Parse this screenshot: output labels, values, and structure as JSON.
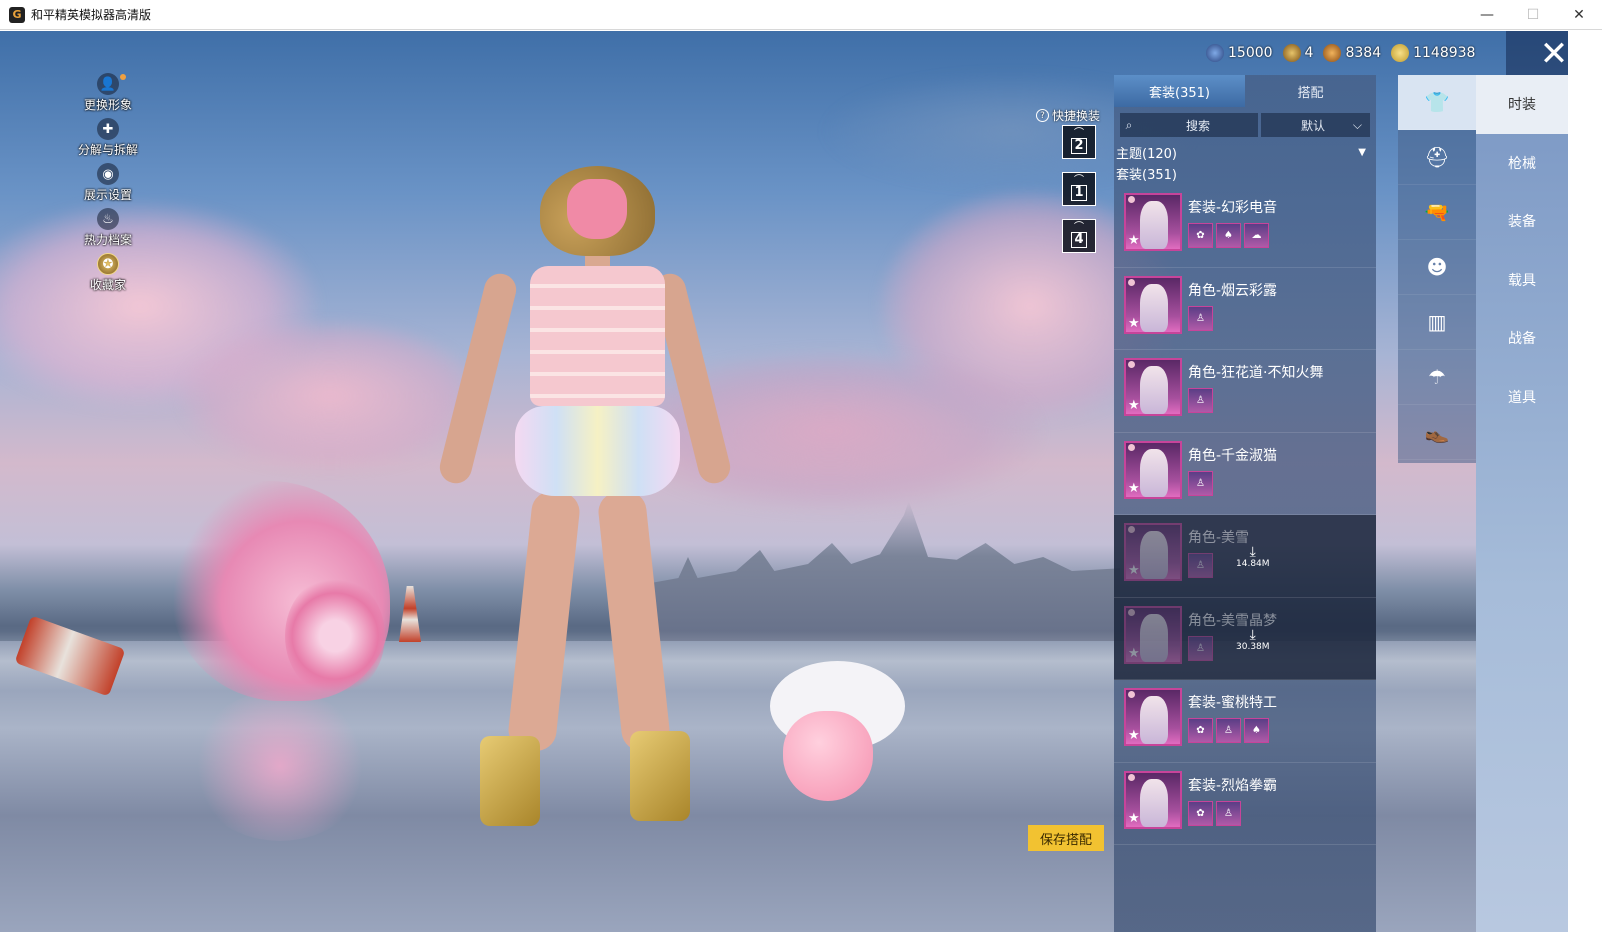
{
  "window": {
    "app_icon": "G",
    "title": "和平精英模拟器高清版",
    "controls": {
      "minimize": "—",
      "maximize": "☐",
      "close": "✕"
    }
  },
  "left_menu": [
    {
      "label": "更换形象",
      "icon": "person-icon",
      "glyph": "👤"
    },
    {
      "label": "分解与拆解",
      "icon": "puzzle-icon",
      "glyph": "✚"
    },
    {
      "label": "展示设置",
      "icon": "eye-icon",
      "glyph": "◉"
    },
    {
      "label": "热力档案",
      "icon": "flame-icon",
      "glyph": "♨"
    },
    {
      "label": "收藏家",
      "icon": "collector-badge-icon",
      "glyph": "✪"
    }
  ],
  "currency": [
    {
      "icon": "globe-coin-icon",
      "value": "15000"
    },
    {
      "icon": "gold-token-icon",
      "value": "4"
    },
    {
      "icon": "bronze-coin-icon",
      "value": "8384"
    },
    {
      "icon": "gold-coin-icon",
      "value": "1148938"
    }
  ],
  "close_label": "✕",
  "quick_swap": {
    "help": "?",
    "title": "快捷换装",
    "slots": [
      {
        "hanger": "⌒",
        "num": "2"
      },
      {
        "hanger": "⌒",
        "num": "1"
      },
      {
        "hanger": "⌒",
        "num": "4"
      }
    ]
  },
  "panel": {
    "tabs": [
      "套装(351)",
      "搭配"
    ],
    "search_icon": "⌕",
    "search_placeholder": "搜索",
    "sort_label": "默认",
    "sort_arrow": "⌵",
    "theme_label": "主题(120)",
    "theme_arrow": "▼",
    "section_title": "套装(351)",
    "star": "★",
    "items": [
      {
        "name": "套装-幻彩电音",
        "subs": [
          "✿",
          "♠",
          "☁"
        ]
      },
      {
        "name": "角色-烟云彩露",
        "subs": [
          "♙"
        ]
      },
      {
        "name": "角色-狂花道·不知火舞",
        "subs": [
          "♙"
        ]
      },
      {
        "name": "角色-千金淑猫",
        "subs": [
          "♙"
        ]
      },
      {
        "name": "角色-美雪",
        "subs": [
          "♙"
        ],
        "download": {
          "icon": "⤓",
          "size": "14.84M"
        }
      },
      {
        "name": "角色-美雪晶梦",
        "subs": [
          "♙"
        ],
        "download": {
          "icon": "⤓",
          "size": "30.38M"
        }
      },
      {
        "name": "套装-蜜桃特工",
        "subs": [
          "✿",
          "♙",
          "♠"
        ]
      },
      {
        "name": "套装-烈焰拳霸",
        "subs": [
          "✿",
          "♙"
        ]
      }
    ]
  },
  "categories": [
    {
      "icon": "outfit-icon",
      "glyph": "👕"
    },
    {
      "icon": "helmet-icon",
      "glyph": "⛑"
    },
    {
      "icon": "weapon-skin-icon",
      "glyph": "🔫"
    },
    {
      "icon": "face-icon",
      "glyph": "☻"
    },
    {
      "icon": "backpack-icon",
      "glyph": "▥"
    },
    {
      "icon": "parachute-icon",
      "glyph": "☂"
    },
    {
      "icon": "shoes-icon",
      "glyph": "👞"
    }
  ],
  "right_tabs": [
    "时装",
    "枪械",
    "装备",
    "载具",
    "战备",
    "道具"
  ],
  "save_button": "保存搭配"
}
